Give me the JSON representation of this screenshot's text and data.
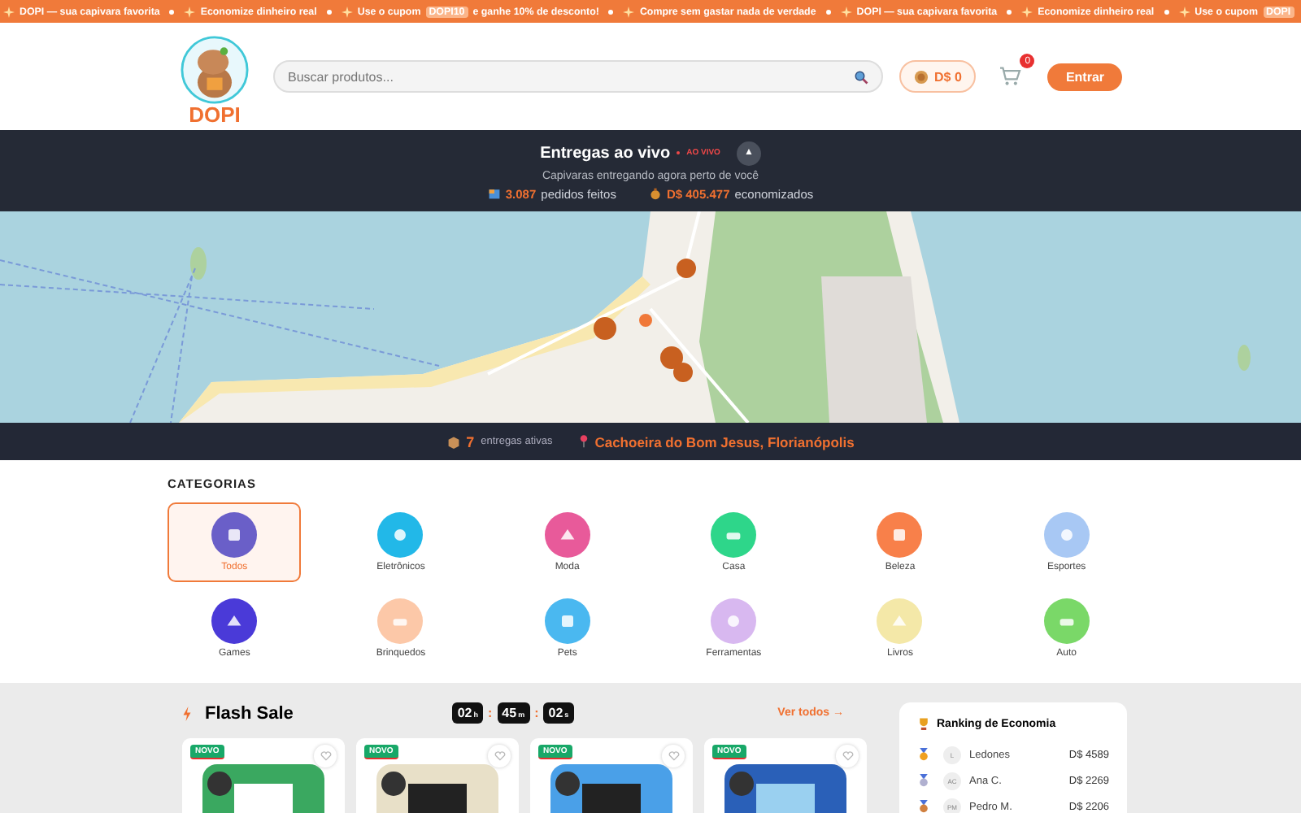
{
  "ticker": [
    {
      "kind": "text",
      "text": "DOPI — sua capivara favorita"
    },
    {
      "kind": "text",
      "text": "Economize dinheiro real"
    },
    {
      "kind": "coupon",
      "before": "Use o cupom",
      "code": "DOPI10",
      "after": "e ganhe 10% de desconto!"
    },
    {
      "kind": "text",
      "text": "Compre sem gastar nada de verdade"
    },
    {
      "kind": "text",
      "text": "DOPI — sua capivara favorita"
    },
    {
      "kind": "text",
      "text": "Economize dinheiro real"
    },
    {
      "kind": "coupon",
      "before": "Use o cupom",
      "code": "DOPI"
    }
  ],
  "header": {
    "logo": "DOPI",
    "search": {
      "placeholder": "Buscar produtos..."
    },
    "balance": "D$ 0",
    "cart_count": "0",
    "login": "Entrar"
  },
  "live": {
    "title": "Entregas ao vivo",
    "badge": "AO VIVO",
    "toggle": "▲",
    "subtitle": "Capivaras entregando agora perto de você",
    "stats": [
      {
        "value": "3.087",
        "label": "pedidos feitos"
      },
      {
        "value": "D$ 405.477",
        "label": "economizados"
      }
    ]
  },
  "map_bar": {
    "count": "7",
    "count_label": "entregas ativas",
    "location": "Cachoeira do Bom Jesus, Florianópolis"
  },
  "categories": {
    "title": "CATEGORIAS",
    "items": [
      {
        "label": "Todos",
        "selected": true,
        "color": "#6a5fc8"
      },
      {
        "label": "Eletrônicos",
        "selected": false,
        "color": "#22b8e8"
      },
      {
        "label": "Moda",
        "selected": false,
        "color": "#e85a9a"
      },
      {
        "label": "Casa",
        "selected": false,
        "color": "#2ed68a"
      },
      {
        "label": "Beleza",
        "selected": false,
        "color": "#f8804a"
      },
      {
        "label": "Esportes",
        "selected": false,
        "color": "#a8c8f4"
      },
      {
        "label": "Games",
        "selected": false,
        "color": "#4a3ad8"
      },
      {
        "label": "Brinquedos",
        "selected": false,
        "color": "#fcc8a8"
      },
      {
        "label": "Pets",
        "selected": false,
        "color": "#4ab8f0"
      },
      {
        "label": "Ferramentas",
        "selected": false,
        "color": "#d8b8f0"
      },
      {
        "label": "Livros",
        "selected": false,
        "color": "#f4e8a8"
      },
      {
        "label": "Auto",
        "selected": false,
        "color": "#7ad868"
      }
    ]
  },
  "flash_sale": {
    "title": "Flash Sale",
    "timer": [
      {
        "value": "02",
        "unit": "h"
      },
      {
        "value": "45",
        "unit": "m"
      },
      {
        "value": "02",
        "unit": "s"
      }
    ],
    "timer_separator": ":",
    "see_all": "Ver todos →",
    "products": [
      {
        "badge": "NOVO"
      },
      {
        "badge": "NOVO"
      },
      {
        "badge": "NOVO"
      },
      {
        "badge": "NOVO"
      }
    ]
  },
  "ranking": {
    "title": "Ranking de Economia",
    "rows": [
      {
        "initials": "L",
        "name": "Ledones",
        "amount": "D$ 4589",
        "color": "#f0a020"
      },
      {
        "initials": "AC",
        "name": "Ana C.",
        "amount": "D$ 2269",
        "color": "#b0b0d0"
      },
      {
        "initials": "PM",
        "name": "Pedro M.",
        "amount": "D$ 2206",
        "color": "#d08040"
      }
    ]
  }
}
